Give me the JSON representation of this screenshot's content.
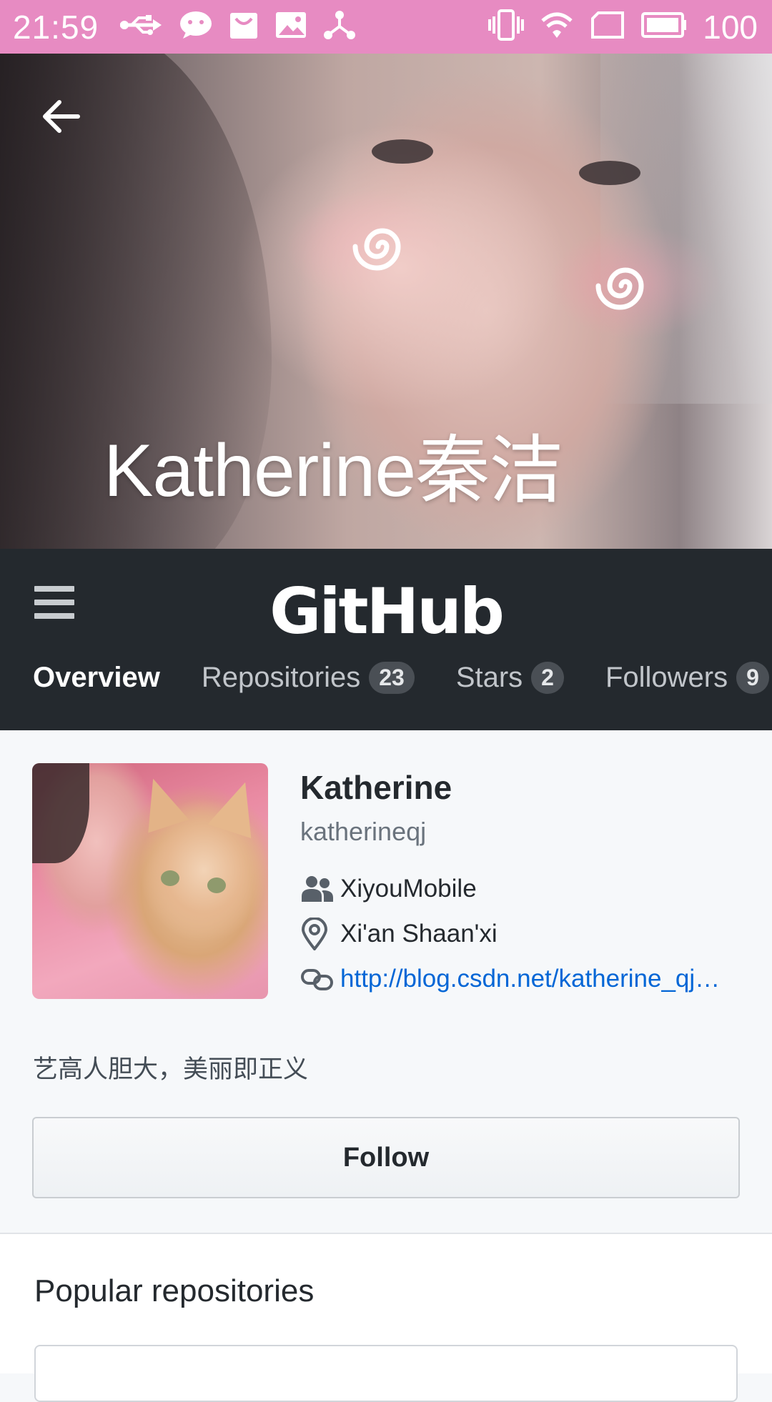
{
  "status_bar": {
    "time": "21:59",
    "battery": "100",
    "left_icons": [
      "usb-icon",
      "wechat-icon",
      "shopping-bag-icon",
      "image-icon",
      "share-icon"
    ],
    "right_icons": [
      "vibrate-icon",
      "wifi-icon",
      "sim-icon",
      "battery-icon"
    ],
    "background": "#e78bc2"
  },
  "hero": {
    "display_name": "Katherine秦洁"
  },
  "github_header": {
    "logo": "GitHub",
    "tabs": [
      {
        "label": "Overview",
        "count": ""
      },
      {
        "label": "Repositories",
        "count": "23"
      },
      {
        "label": "Stars",
        "count": "2"
      },
      {
        "label": "Followers",
        "count": "9"
      }
    ],
    "background": "#24292e"
  },
  "profile": {
    "name": "Katherine",
    "login": "katherineqj",
    "organization": "XiyouMobile",
    "location": "Xi'an Shaan'xi",
    "website": "http://blog.csdn.net/katherine_qj…",
    "bio": "艺高人胆大，美丽即正义",
    "follow_label": "Follow"
  },
  "popular": {
    "heading": "Popular repositories"
  }
}
